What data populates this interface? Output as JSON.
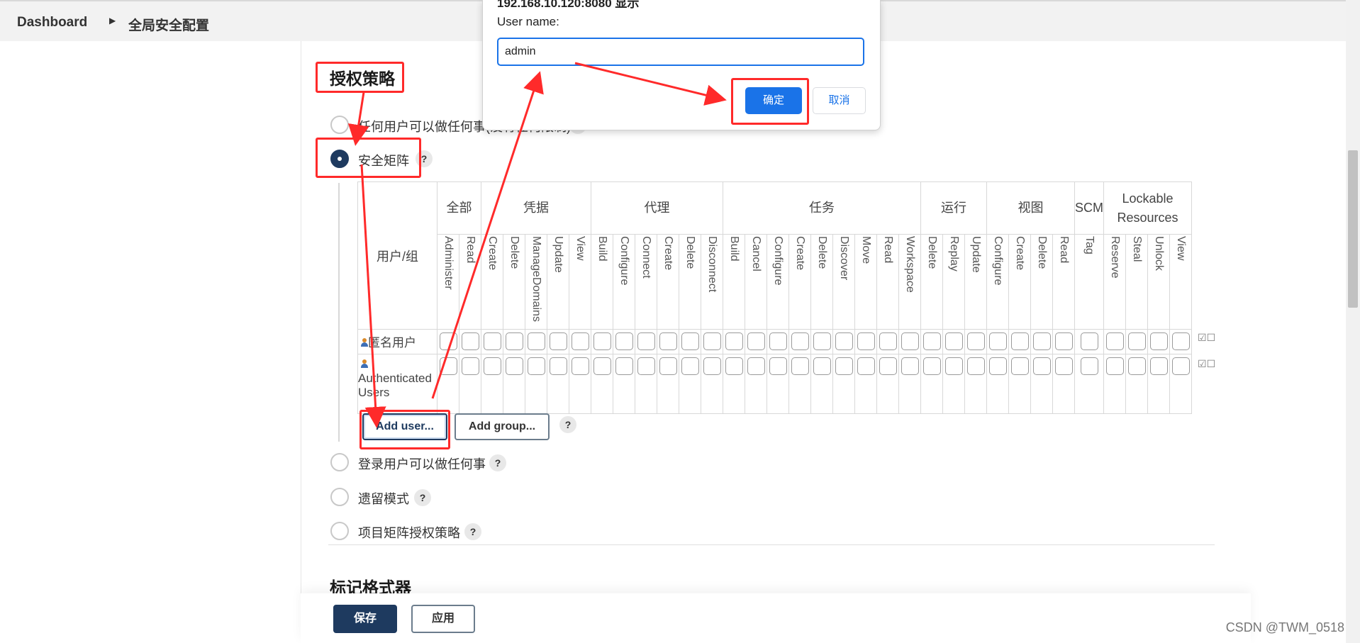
{
  "breadcrumb": {
    "home": "Dashboard",
    "current": "全局安全配置"
  },
  "authorization": {
    "title": "授权策略",
    "options": [
      {
        "label": "任何用户可以做任何事(没有任何限制)",
        "checked": false
      },
      {
        "label": "安全矩阵",
        "checked": true
      },
      {
        "label": "登录用户可以做任何事",
        "checked": false
      },
      {
        "label": "遗留模式",
        "checked": false
      },
      {
        "label": "项目矩阵授权策略",
        "checked": false
      }
    ],
    "help": "?"
  },
  "matrix": {
    "user_group_header": "用户/组",
    "groups": [
      {
        "name": "全部",
        "span": 2
      },
      {
        "name": "凭据",
        "span": 5
      },
      {
        "name": "代理",
        "span": 6
      },
      {
        "name": "任务",
        "span": 9
      },
      {
        "name": "运行",
        "span": 3
      },
      {
        "name": "视图",
        "span": 4
      },
      {
        "name": "SCM",
        "span": 1
      },
      {
        "name": "Lockable Resources",
        "span": 4
      }
    ],
    "permissions": [
      "Administer",
      "Read",
      "Create",
      "Delete",
      "ManageDomains",
      "Update",
      "View",
      "Build",
      "Configure",
      "Connect",
      "Create",
      "Delete",
      "Disconnect",
      "Build",
      "Cancel",
      "Configure",
      "Create",
      "Delete",
      "Discover",
      "Move",
      "Read",
      "Workspace",
      "Delete",
      "Replay",
      "Update",
      "Configure",
      "Create",
      "Delete",
      "Read",
      "Tag",
      "Reserve",
      "Steal",
      "Unlock",
      "View"
    ],
    "rows": [
      {
        "name": "匿名用户"
      },
      {
        "name": "Authenticated Users"
      }
    ],
    "row_tools": {
      "check_all": "☑",
      "uncheck_all": "☐"
    }
  },
  "buttons": {
    "add_user": "Add user...",
    "add_group": "Add group...",
    "save": "保存",
    "apply": "应用"
  },
  "markup_section": {
    "title": "标记格式器"
  },
  "dialog": {
    "title": "192.168.10.120:8080 显示",
    "label": "User name:",
    "value": "admin",
    "ok": "确定",
    "cancel": "取消"
  },
  "watermark": "CSDN @TWM_0518",
  "colors": {
    "annotation": "#ff2a2a",
    "primary": "#1e3a5f",
    "dialog_accent": "#1a73e8"
  }
}
